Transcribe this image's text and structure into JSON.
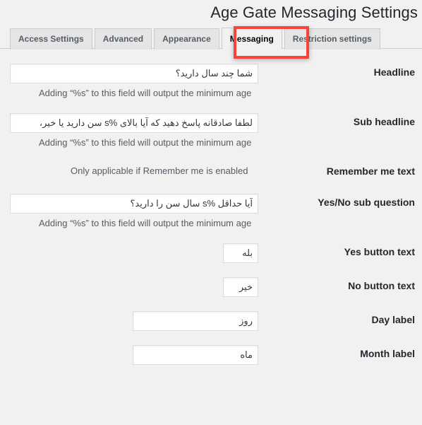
{
  "page": {
    "title": "Age Gate Messaging Settings"
  },
  "tabs": [
    {
      "label": "Access Settings",
      "active": false
    },
    {
      "label": "Advanced",
      "active": false
    },
    {
      "label": "Appearance",
      "active": false
    },
    {
      "label": "Messaging",
      "active": true
    },
    {
      "label": "Restriction settings",
      "active": false
    }
  ],
  "highlight": {
    "color": "#f9423a",
    "target": "Messaging"
  },
  "help_text": {
    "minimum_age": "Adding “%s” to this field will output the minimum age",
    "remember_me": "Only applicable if Remember me is enabled"
  },
  "fields": {
    "headline": {
      "label": "Headline",
      "value": "شما چند سال دارید؟"
    },
    "sub_headline": {
      "label": "Sub headline",
      "value": "لطفا صادقانه پاسخ دهید که آیا بالای %s سن دارید یا خیر،"
    },
    "remember_me_text": {
      "label": "Remember me text",
      "value": ""
    },
    "yes_no_sub_question": {
      "label": "Yes/No sub question",
      "value": "آیا حداقل %s سال سن را دارید؟"
    },
    "yes_button_text": {
      "label": "Yes button text",
      "value": "بله"
    },
    "no_button_text": {
      "label": "No button text",
      "value": "خیر"
    },
    "day_label": {
      "label": "Day label",
      "value": "روز"
    },
    "month_label": {
      "label": "Month label",
      "value": "ماه"
    }
  }
}
